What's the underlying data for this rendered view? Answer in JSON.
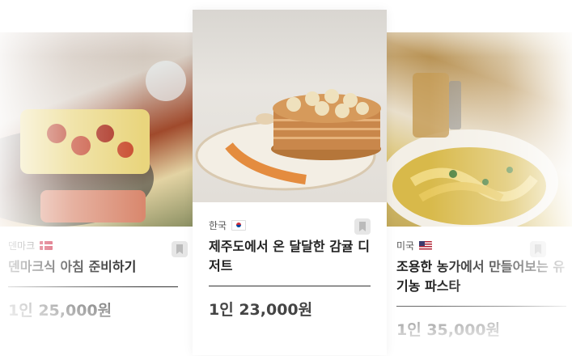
{
  "cards": [
    {
      "country": "덴마크",
      "flag": "dk",
      "title": "덴마크식 아침 준비하기",
      "price": "1인 25,000원"
    },
    {
      "country": "한국",
      "flag": "kr",
      "title": "제주도에서 온 달달한 감귤 디저트",
      "price": "1인 23,000원"
    },
    {
      "country": "미국",
      "flag": "us",
      "title": "조용한 농가에서 만들어보는 유기농 파스타",
      "price": "1인 35,000원"
    }
  ],
  "icons": {
    "bookmark": "bookmark-icon"
  },
  "colors": {
    "accent_orange": "#e07a22",
    "text": "#222222"
  }
}
